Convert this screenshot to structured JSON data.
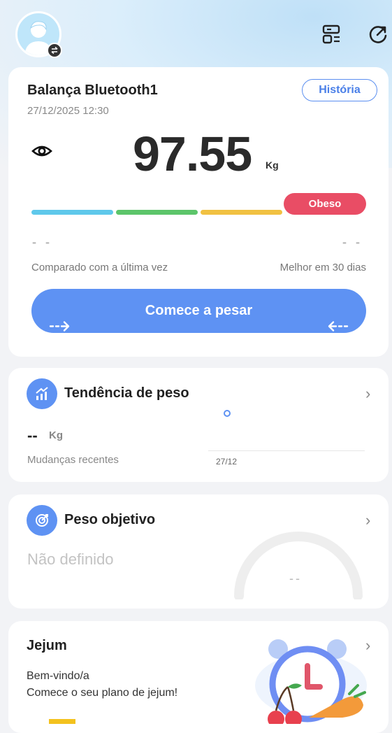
{
  "device": {
    "name": "Balança Bluetooth1",
    "datetime": "27/12/2025 12:30",
    "history_label": "História"
  },
  "weight": {
    "value": "97.55",
    "unit": "Kg",
    "status": "Obeso",
    "status_color": "#e94d65"
  },
  "bmi_bar": {
    "segments": [
      {
        "color": "#5fc8eb"
      },
      {
        "color": "#5cc56a"
      },
      {
        "color": "#f1c142"
      },
      {
        "color": "#e94d65"
      }
    ]
  },
  "comparison": {
    "left_value": "- -",
    "right_value": "- -",
    "left_label": "Comparado com a última vez",
    "right_label": "Melhor em 30 dias"
  },
  "start_button": {
    "label": "Comece a pesar",
    "left_arrow": "- - →",
    "right_arrow": "← - -"
  },
  "trend": {
    "title": "Tendência de peso",
    "value": "--",
    "unit": "Kg",
    "subtitle": "Mudanças recentes",
    "date_label": "27/12"
  },
  "goal": {
    "title": "Peso objetivo",
    "value": "Não definido",
    "gauge_value": "--"
  },
  "fasting": {
    "title": "Jejum",
    "line1": "Bem-vindo/a",
    "line2": "Comece o seu plano de jejum!"
  },
  "colors": {
    "accent": "#5e92f3"
  }
}
